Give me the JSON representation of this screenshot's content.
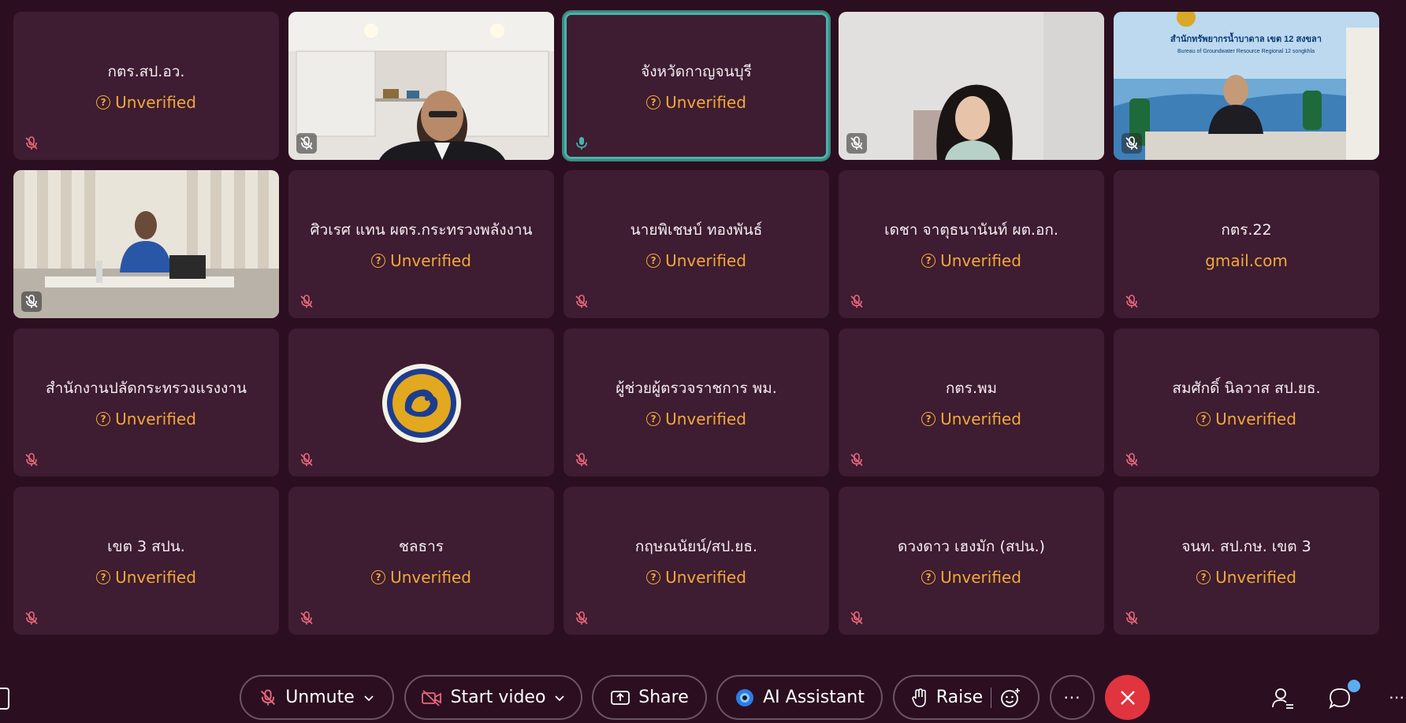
{
  "status_label": "Unverified",
  "tiles": [
    {
      "name": "กตร.สป.อว.",
      "status": "Unverified"
    },
    {
      "name": "",
      "status": ""
    },
    {
      "name": "จังหวัดกาญจนบุรี",
      "status": "Unverified"
    },
    {
      "name": "",
      "status": ""
    },
    {
      "name": "",
      "status": "",
      "video_banner_title": "สำนักทรัพยากรน้ำบาดาล เขต 12 สงขลา",
      "video_banner_subtitle": "Bureau of Groundwater Resource Regional 12 songkhla"
    },
    {
      "name": "",
      "status": ""
    },
    {
      "name": "ศิวเรศ แทน ผตร.กระทรวงพลังงาน",
      "status": "Unverified"
    },
    {
      "name": "นายพิเชษบ์ ทองพันธ์",
      "status": "Unverified"
    },
    {
      "name": "เดชา จาตุธนานันท์ ผต.อก.",
      "status": "Unverified"
    },
    {
      "name": "กตร.22",
      "status": "gmail.com"
    },
    {
      "name": "สำนักงานปลัดกระทรวงแรงงาน",
      "status": "Unverified"
    },
    {
      "name": "",
      "status": ""
    },
    {
      "name": "ผู้ช่วยผู้ตรวจราชการ พม.",
      "status": "Unverified"
    },
    {
      "name": "กตร.พม",
      "status": "Unverified"
    },
    {
      "name": "สมศักดิ์ นิลวาส สป.ยธ.",
      "status": "Unverified"
    },
    {
      "name": "เขต 3 สปน.",
      "status": "Unverified"
    },
    {
      "name": "ชลธาร",
      "status": "Unverified"
    },
    {
      "name": "กฤษณนัยน์/สป.ยธ.",
      "status": "Unverified"
    },
    {
      "name": "ดวงดาว เฮงมัก (สปน.)",
      "status": "Unverified"
    },
    {
      "name": "จนท. สป.กษ. เขต 3",
      "status": "Unverified"
    }
  ],
  "controls": {
    "unmute": "Unmute",
    "start_video": "Start video",
    "share": "Share",
    "ai_assistant": "AI Assistant",
    "raise": "Raise",
    "more": "···"
  },
  "colors": {
    "background": "#2b0f20",
    "tile": "#3e1c31",
    "unverified": "#f0a93a",
    "end_call": "#e0343f",
    "active_border": "#48b3a8",
    "muted_icon": "#e8677b"
  }
}
